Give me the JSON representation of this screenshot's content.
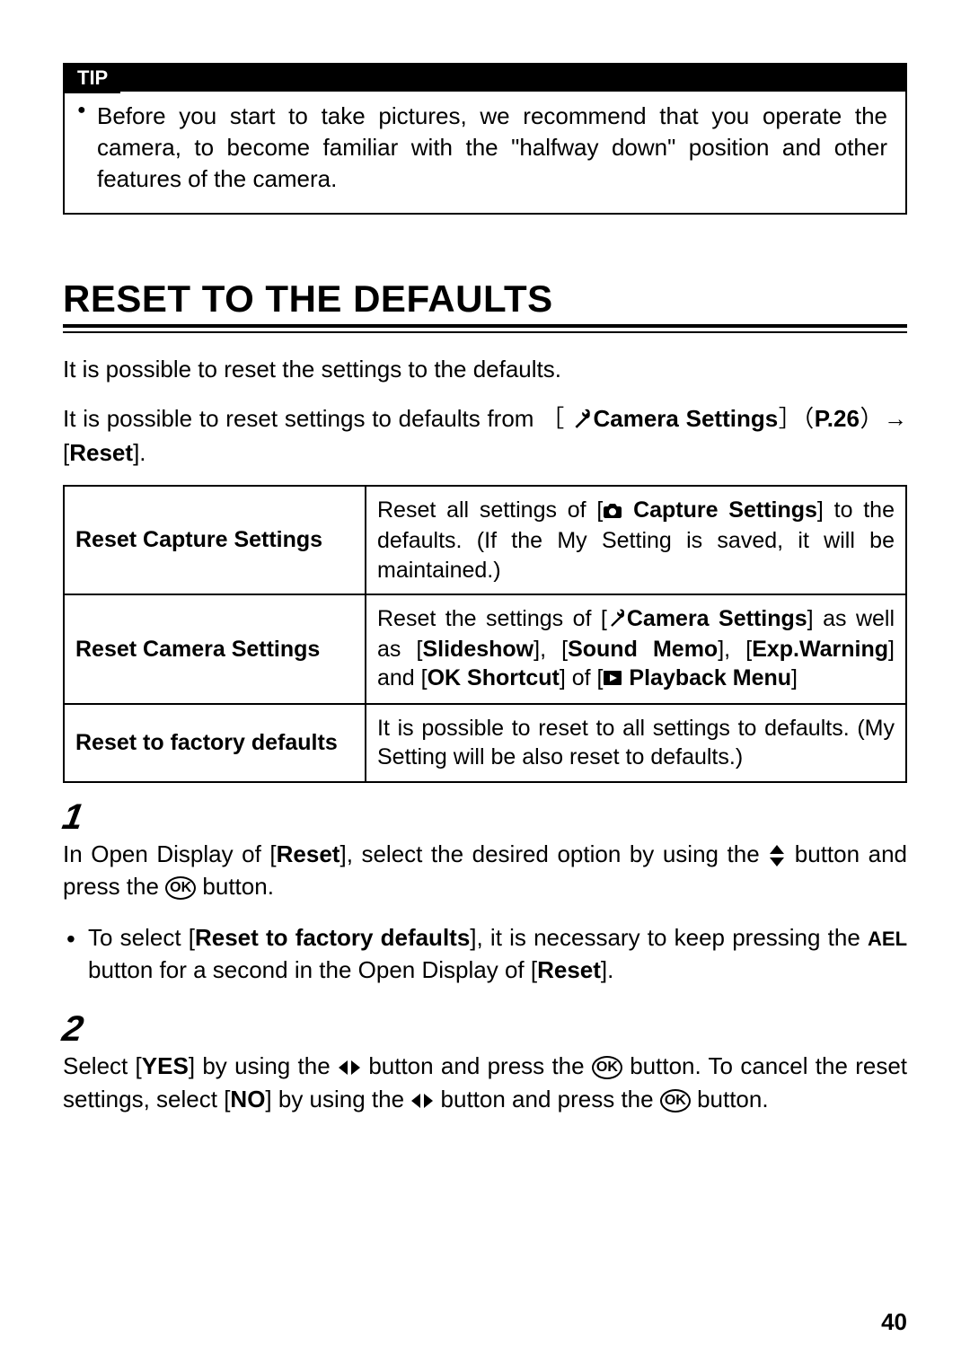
{
  "tip": {
    "label": "TIP",
    "body": "Before you start to take pictures, we recommend that you operate the camera, to become familiar with the \"halfway down\" position and other features of the camera."
  },
  "section_title": "RESET TO THE DEFAULTS",
  "intro1": "It is possible to reset the settings to the defaults.",
  "intro2_a": "It is possible to reset settings to defaults from ［",
  "intro2_b": "Camera Settings",
  "intro2_c": "］（",
  "intro2_d": "P.26",
  "intro2_e": "）→ [",
  "intro2_f": "Reset",
  "intro2_g": "].",
  "table": {
    "rows": [
      {
        "left": "Reset Capture Settings",
        "right_a": "Reset all settings of [",
        "right_b": " Capture Settings",
        "right_c": "] to the defaults. (If the My Setting is saved, it will be maintained.)"
      },
      {
        "left": "Reset Camera Settings",
        "right_a": "Reset the settings of [",
        "right_b": "Camera Settings",
        "right_c": "] as well as [",
        "right_d": "Slideshow",
        "right_e": "], [",
        "right_f": "Sound Memo",
        "right_g": "], [",
        "right_h": "Exp.Warning",
        "right_i": "] and [",
        "right_j": "OK Shortcut",
        "right_k": "] of [",
        "right_l": " Playback Menu",
        "right_m": "]"
      },
      {
        "left": "Reset to factory defaults",
        "right": "It is possible to reset to all settings to defaults. (My Setting will be also reset to defaults.)"
      }
    ]
  },
  "step1_num": "1",
  "step1_a": "In Open Display of [",
  "step1_b": "Reset",
  "step1_c": "], select the desired option by using the ",
  "step1_d": " button and press the ",
  "step1_e": " button.",
  "bullet_a": "To select [",
  "bullet_b": "Reset to factory defaults",
  "bullet_c": "], it is necessary to keep pressing the ",
  "bullet_d": "AEL",
  "bullet_e": " button for a second in the Open Display of [",
  "bullet_f": "Reset",
  "bullet_g": "].",
  "step2_num": "2",
  "step2_a": "Select [",
  "step2_b": "YES",
  "step2_c": "] by using the ",
  "step2_d": " button and press the ",
  "step2_e": " button. To cancel the reset settings, select [",
  "step2_f": "NO",
  "step2_g": "] by using the ",
  "step2_h": " button and press the ",
  "step2_i": " button.",
  "ok_label": "OK",
  "page_number": "40"
}
